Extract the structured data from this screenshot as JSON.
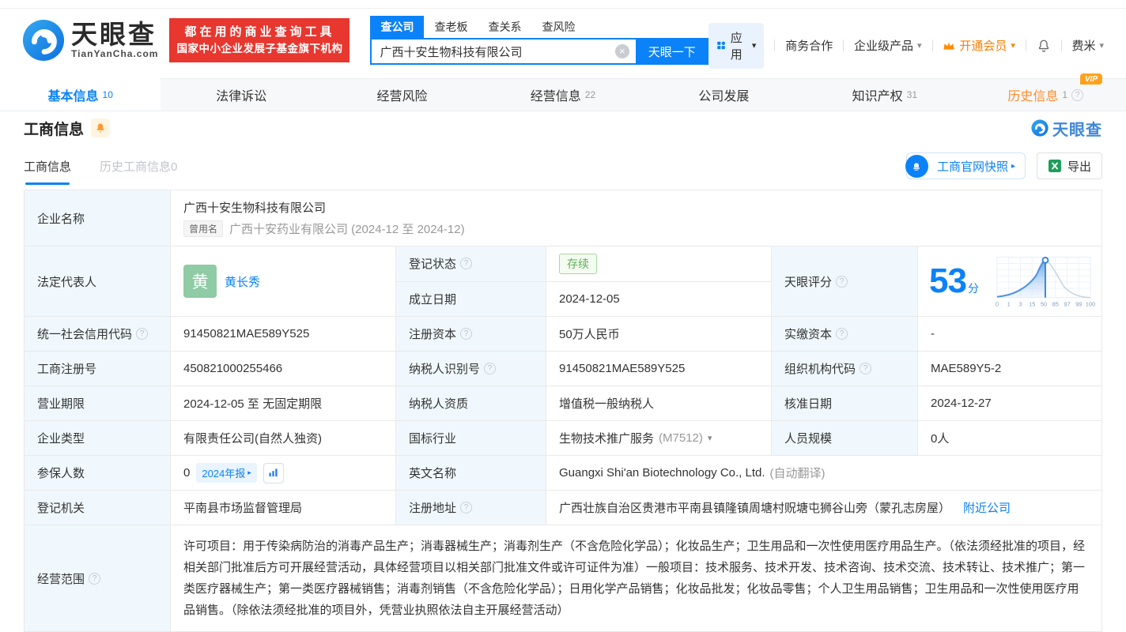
{
  "header": {
    "logo_title": "天眼查",
    "logo_sub": "TianYanCha.com",
    "promo_line1": "都在用的商业查询工具",
    "promo_line2": "国家中小企业发展子基金旗下机构",
    "search_tabs": [
      "查公司",
      "查老板",
      "查关系",
      "查风险"
    ],
    "search_value": "广西十安生物科技有限公司",
    "search_button": "天眼一下",
    "menu_apps": "应用",
    "menu_coop": "商务合作",
    "menu_enterprise": "企业级产品",
    "menu_vip": "开通会员",
    "menu_user": "费米"
  },
  "nav_tabs": [
    {
      "label": "基本信息",
      "count": "10"
    },
    {
      "label": "法律诉讼",
      "count": ""
    },
    {
      "label": "经营风险",
      "count": ""
    },
    {
      "label": "经营信息",
      "count": "22"
    },
    {
      "label": "公司发展",
      "count": ""
    },
    {
      "label": "知识产权",
      "count": "31"
    },
    {
      "label": "历史信息",
      "count": "1",
      "vip": "VIP"
    }
  ],
  "section_title": "工商信息",
  "brand_watermark": "天眼查",
  "subtabs": {
    "active": "工商信息",
    "history": "历史工商信息0",
    "snapshot": "工商官网快照",
    "export": "导出"
  },
  "fields": {
    "company_name_label": "企业名称",
    "company_name": "广西十安生物科技有限公司",
    "former_name_tag": "曾用名",
    "former_name": "广西十安药业有限公司 (2024-12 至 2024-12)",
    "legal_rep_label": "法定代表人",
    "legal_rep_avatar": "黄",
    "legal_rep_name": "黄长秀",
    "reg_status_label": "登记状态",
    "reg_status": "存续",
    "establish_label": "成立日期",
    "establish_date": "2024-12-05",
    "score_label": "天眼评分",
    "score_value": "53",
    "score_unit": "分",
    "score_axis": [
      "0",
      "1",
      "3",
      "15",
      "50",
      "85",
      "97",
      "99",
      "100"
    ],
    "credit_code_label": "统一社会信用代码",
    "credit_code": "91450821MAE589Y525",
    "reg_capital_label": "注册资本",
    "reg_capital": "50万人民币",
    "paid_capital_label": "实缴资本",
    "paid_capital": "-",
    "reg_no_label": "工商注册号",
    "reg_no": "450821000255466",
    "taxpayer_id_label": "纳税人识别号",
    "taxpayer_id": "91450821MAE589Y525",
    "org_code_label": "组织机构代码",
    "org_code": "MAE589Y5-2",
    "term_label": "营业期限",
    "term": "2024-12-05 至 无固定期限",
    "taxpayer_quality_label": "纳税人资质",
    "taxpayer_quality": "增值税一般纳税人",
    "approval_label": "核准日期",
    "approval_date": "2024-12-27",
    "type_label": "企业类型",
    "type": "有限责任公司(自然人独资)",
    "industry_label": "国标行业",
    "industry": "生物技术推广服务",
    "industry_code": "(M7512)",
    "staff_label": "人员规模",
    "staff": "0人",
    "insured_label": "参保人数",
    "insured": "0",
    "insured_report": "2024年报",
    "en_name_label": "英文名称",
    "en_name": "Guangxi Shi'an Biotechnology Co., Ltd.",
    "en_name_note": "(自动翻译)",
    "authority_label": "登记机关",
    "authority": "平南县市场监督管理局",
    "address_label": "注册地址",
    "address": "广西壮族自治区贵港市平南县镇隆镇周塘村贶塘屯狮谷山旁（蒙孔志房屋）",
    "nearby": "附近公司",
    "scope_label": "经营范围",
    "scope": "许可项目：用于传染病防治的消毒产品生产；消毒器械生产；消毒剂生产（不含危险化学品）；化妆品生产；卫生用品和一次性使用医疗用品生产。（依法须经批准的项目，经相关部门批准后方可开展经营活动，具体经营项目以相关部门批准文件或许可证件为准）一般项目：技术服务、技术开发、技术咨询、技术交流、技术转让、技术推广；第一类医疗器械生产；第一类医疗器械销售；消毒剂销售（不含危险化学品）；日用化学产品销售；化妆品批发；化妆品零售；个人卫生用品销售；卫生用品和一次性使用医疗用品销售。（除依法须经批准的项目外，凭营业执照依法自主开展经营活动）"
  },
  "icons": {
    "help": "?",
    "clear": "×",
    "caret_down": "▾",
    "caret_right": "▸"
  },
  "colors": {
    "primary_blue": "#0b82f7",
    "promo_red": "#e7372f",
    "member_orange": "#ff7e00",
    "vip_badge_orange": "#ffa21c",
    "status_green": "#5fae5a",
    "label_bg": "#f0f8fd"
  }
}
